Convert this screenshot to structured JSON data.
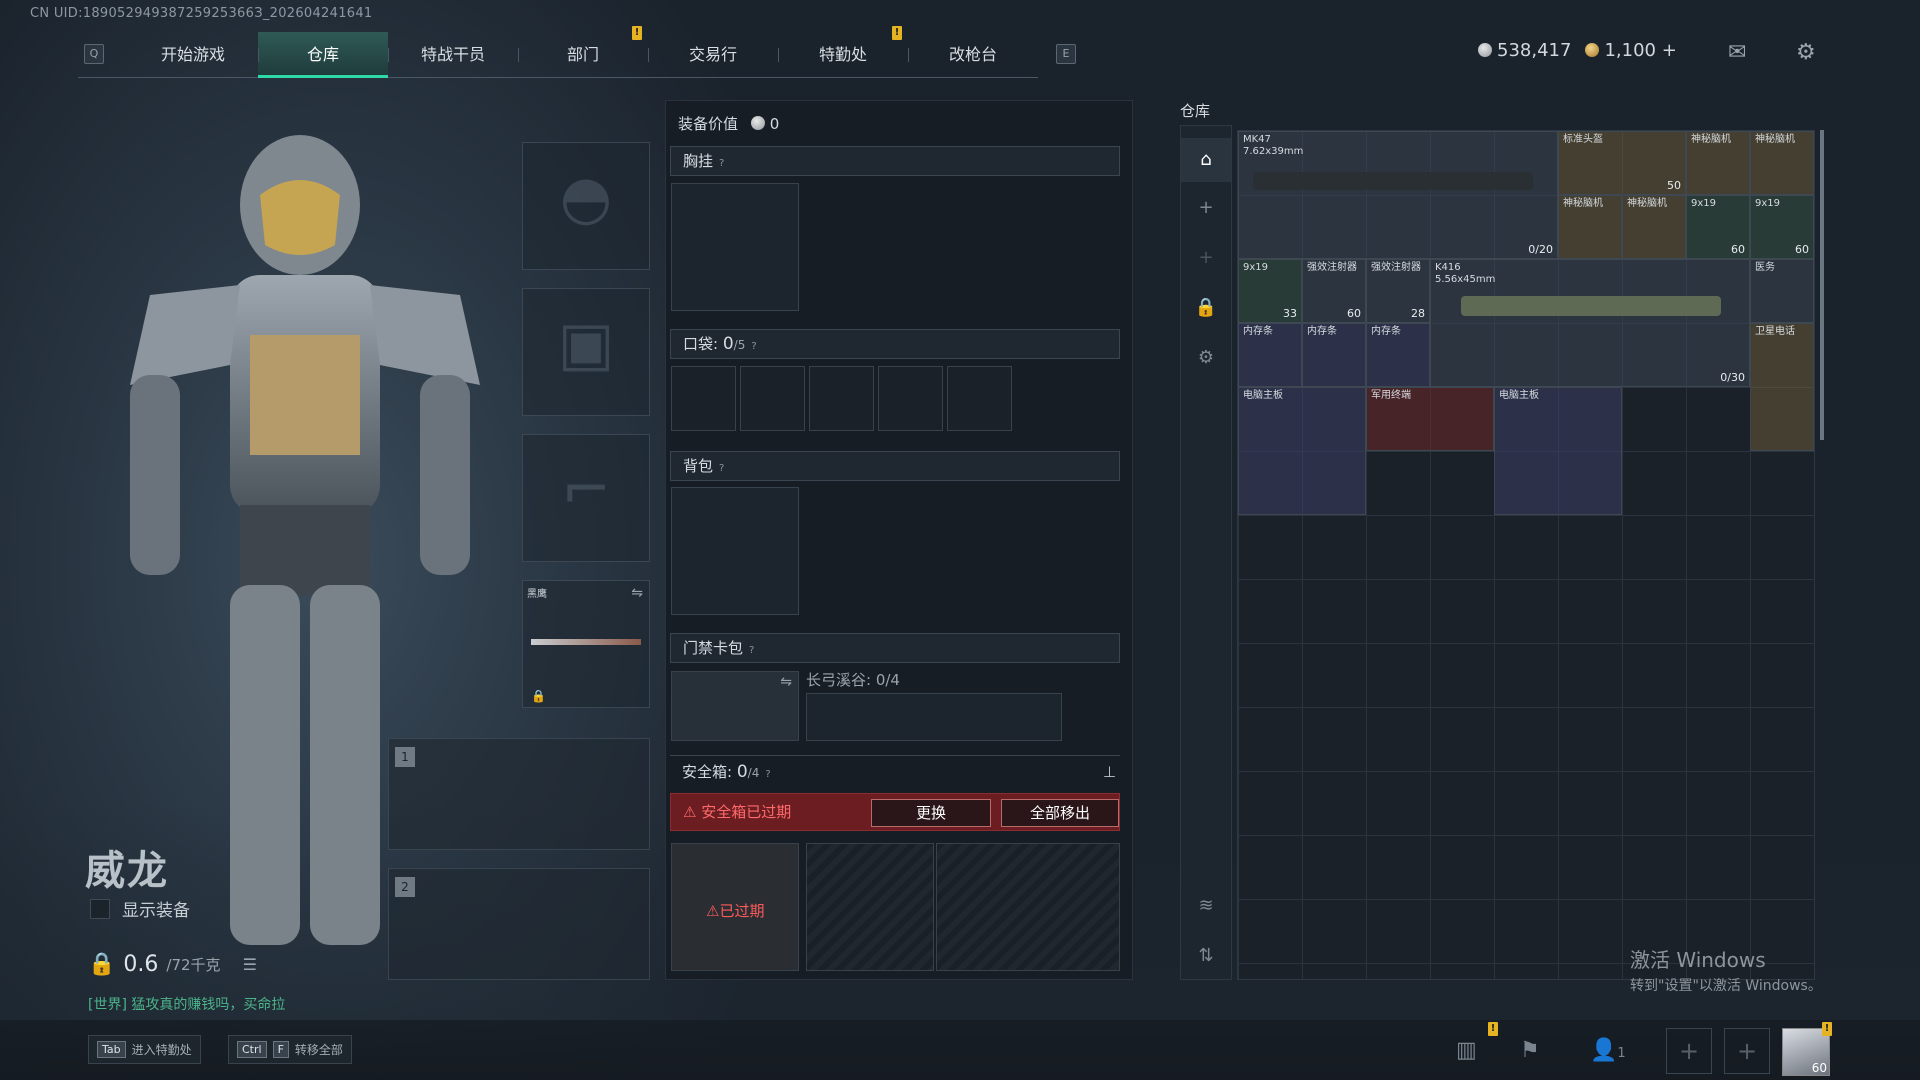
{
  "uid": "CN UID:18905294938725925366З_202604241641",
  "nav": {
    "left_key": "Q",
    "right_key": "E",
    "tabs": [
      "开始游戏",
      "仓库",
      "特战干员",
      "部门",
      "交易行",
      "特勤处",
      "改枪台"
    ],
    "active": "仓库"
  },
  "currency": {
    "silver": "538,417",
    "gold": "1,100",
    "gold_plus": "+"
  },
  "character": {
    "name": "威龙",
    "show_equipment": "显示装备",
    "weight": "0.6",
    "weight_max": "/72千克",
    "chat": "[世界] 猛攻真的赚钱吗，买命拉"
  },
  "melee": {
    "name": "黑鹰"
  },
  "weapon_slots": [
    "1",
    "2"
  ],
  "mid": {
    "value_label": "装备价值",
    "value": "0",
    "vest": "胸挂",
    "pocket": "口袋:",
    "pocket_count": "0",
    "pocket_max": "/5",
    "backpack": "背包",
    "keycard": "门禁卡包",
    "keycard_zone": "长弓溪谷: 0/4",
    "safe": "安全箱:",
    "safe_count": "0",
    "safe_max": "/4",
    "safe_expired": "安全箱已过期",
    "replace": "更换",
    "move_all": "全部移出",
    "expired_tag": "已过期"
  },
  "warehouse": {
    "title": "仓库",
    "items": [
      {
        "name": "MK47\n7.62x39mm",
        "count": "0/20"
      },
      {
        "name": "标准头盔",
        "count": "50"
      },
      {
        "name": "神秘脑机",
        "count": ""
      },
      {
        "name": "神秘脑机",
        "count": ""
      },
      {
        "name": "神秘脑机",
        "count": ""
      },
      {
        "name": "神秘脑机",
        "count": ""
      },
      {
        "name": "9x19",
        "count": "60"
      },
      {
        "name": "9x19",
        "count": "60"
      },
      {
        "name": "9x19",
        "count": "33"
      },
      {
        "name": "强效注射器",
        "count": "60"
      },
      {
        "name": "强效注射器",
        "count": "28"
      },
      {
        "name": "K416\n5.56x45mm",
        "count": "0/30"
      },
      {
        "name": "医务",
        "count": ""
      },
      {
        "name": "内存条",
        "count": ""
      },
      {
        "name": "内存条",
        "count": ""
      },
      {
        "name": "内存条",
        "count": ""
      },
      {
        "name": "卫星电话",
        "count": ""
      },
      {
        "name": "电脑主板",
        "count": ""
      },
      {
        "name": "军用终端",
        "count": ""
      },
      {
        "name": "电脑主板",
        "count": ""
      }
    ]
  },
  "activate": {
    "title": "激活 Windows",
    "sub": "转到\"设置\"以激活 Windows。"
  },
  "hotkeys": [
    {
      "keys": [
        "Tab"
      ],
      "label": "进入特勤处"
    },
    {
      "keys": [
        "Ctrl",
        "F"
      ],
      "label": "转移全部"
    }
  ],
  "party_count": "1",
  "avatar_level": "60"
}
